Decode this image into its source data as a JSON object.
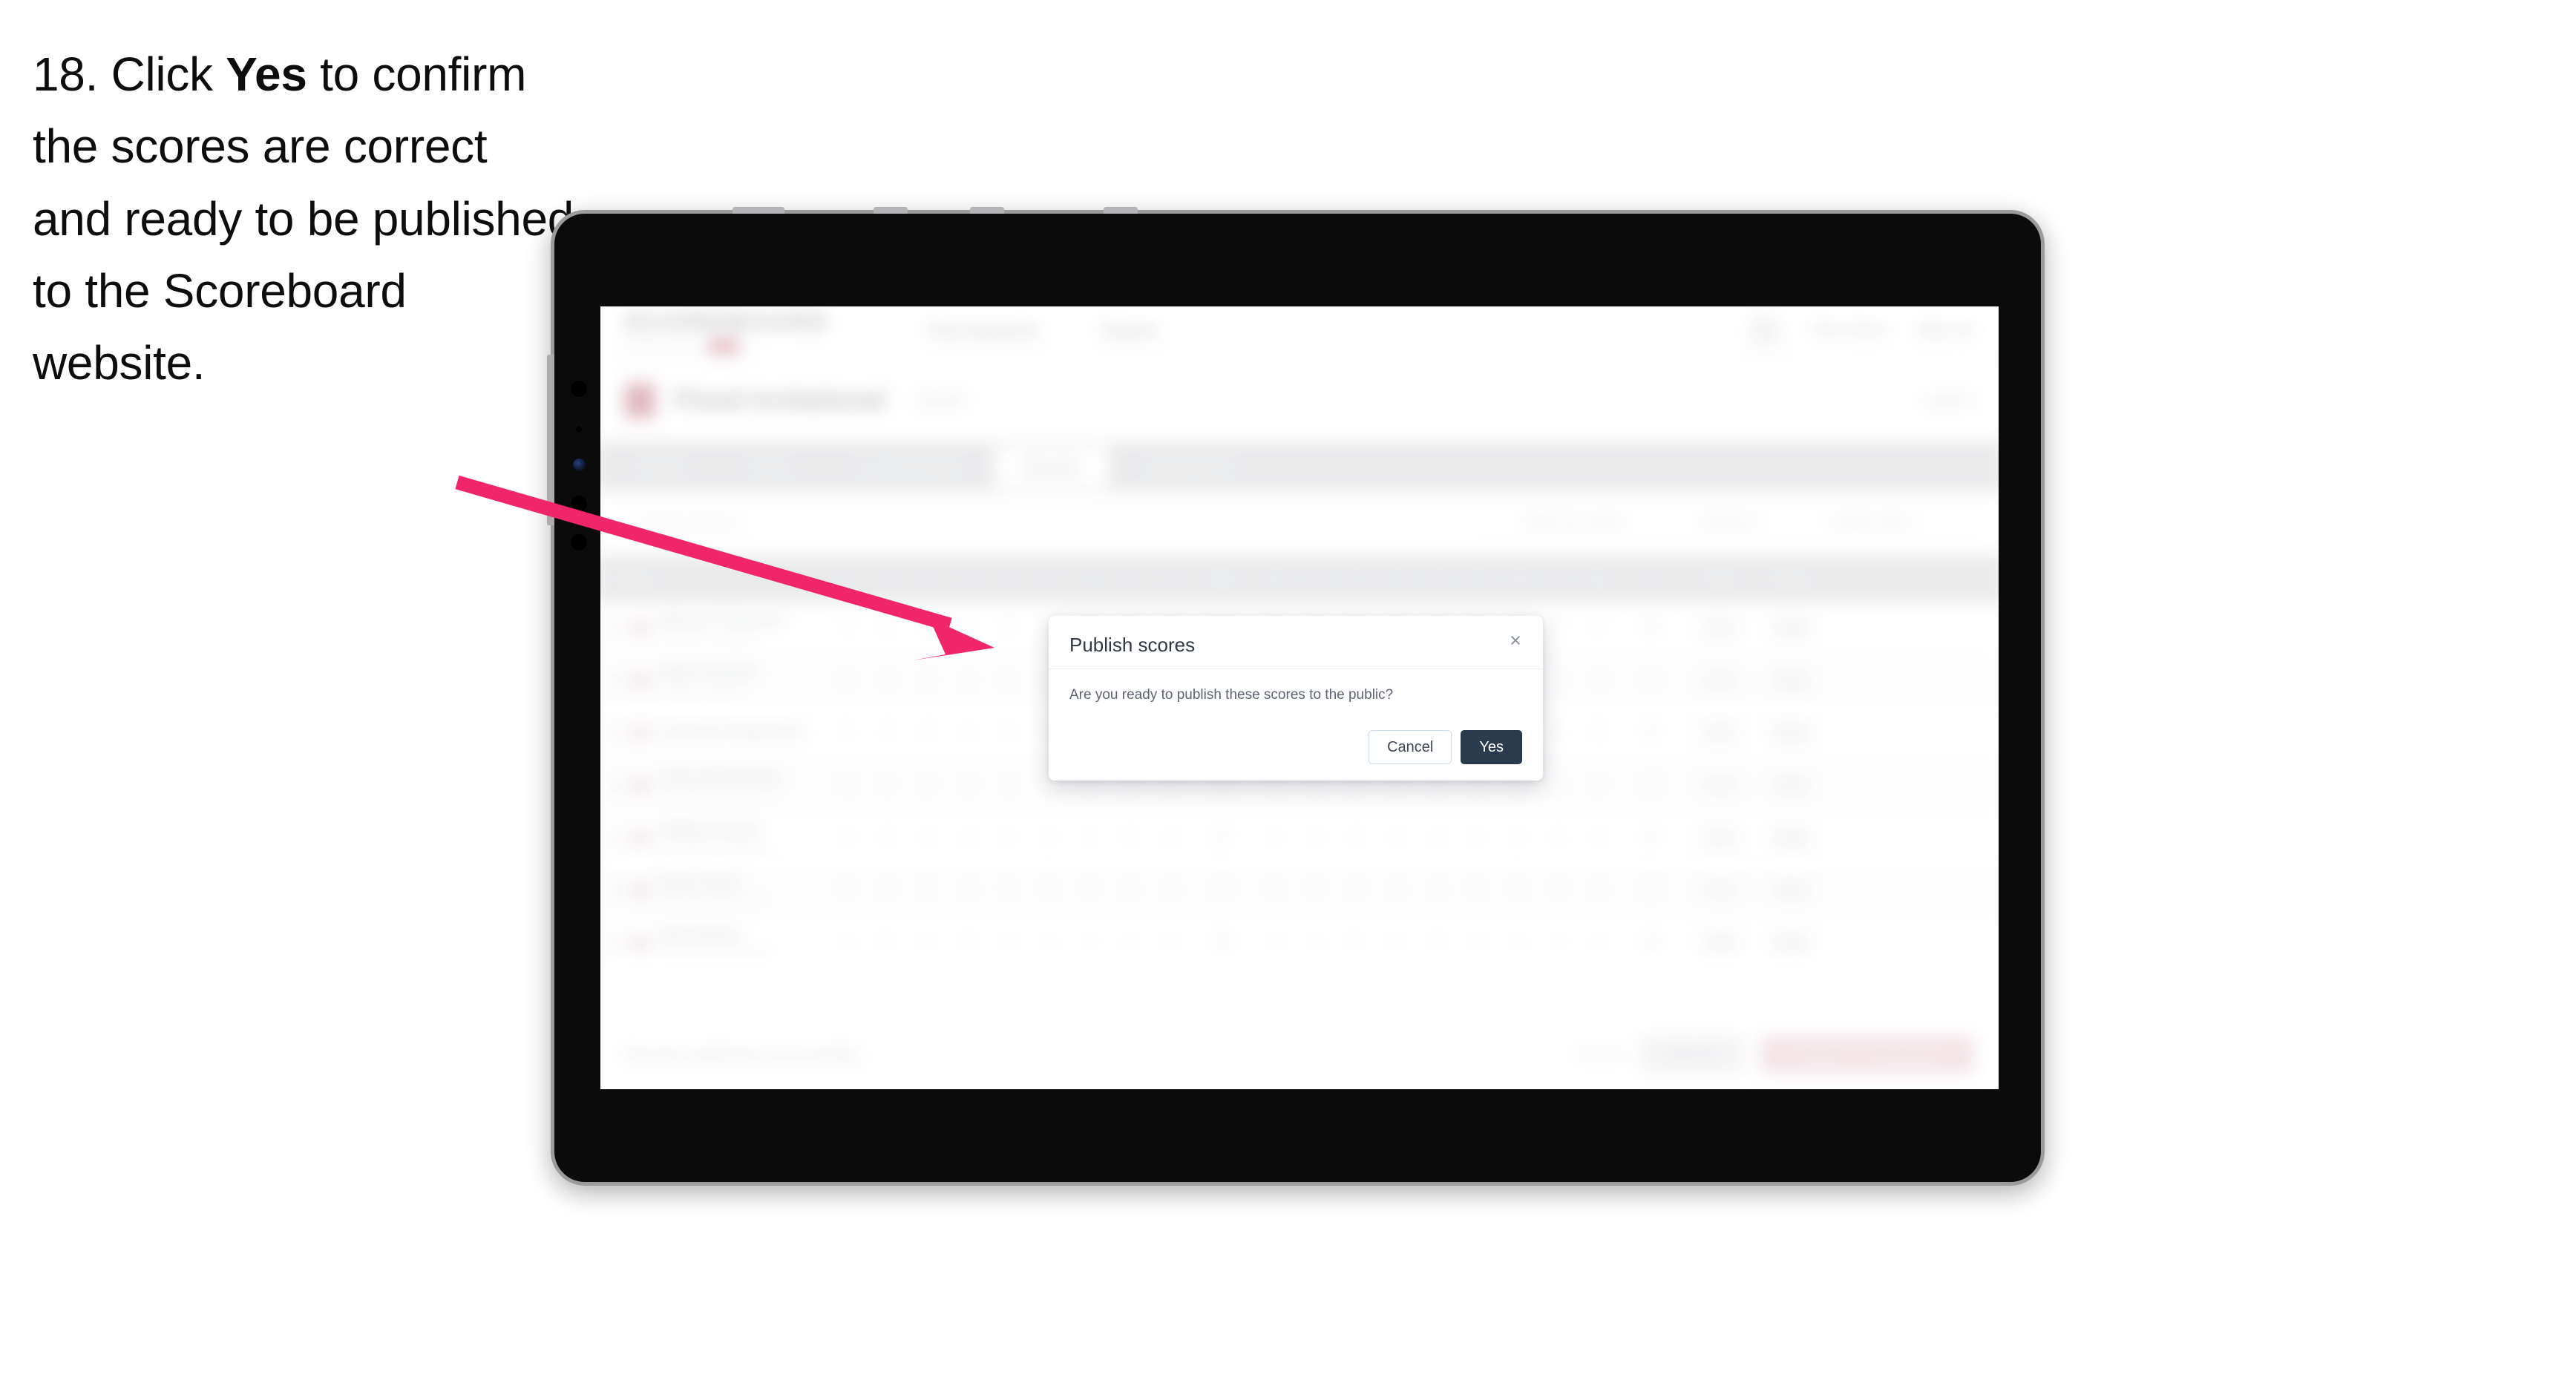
{
  "caption": {
    "step_number": "18.",
    "text_before": "Click ",
    "emphasis": "Yes",
    "text_after": " to confirm the scores are correct and ready to be published to the Scoreboard website."
  },
  "annotation": {
    "arrow_color": "#f0256a",
    "arrow_name": "pointer-arrow"
  },
  "device": {
    "type": "tablet",
    "body_color": "#0b0b0b",
    "bezel_color": "#9b9b9d"
  },
  "app": {
    "header": {
      "brand_word": "SCOREBOARD",
      "brand_sub_text": "POWERED BY",
      "brand_chip": "ITF",
      "nav": [
        {
          "label": "Tournaments"
        },
        {
          "label": "Teams"
        }
      ],
      "right": [
        {
          "label": "Tom Jones"
        },
        {
          "label": "Sign out"
        }
      ]
    },
    "tournament": {
      "name": "Flood Invitational",
      "meta": "2024",
      "right_label": "Level 3"
    },
    "tabs": [
      {
        "label": "Details"
      },
      {
        "label": "Teams"
      },
      {
        "label": "Courses/Rules"
      },
      {
        "label": "Results"
      },
      {
        "label": "Leaderboard"
      }
    ],
    "active_tab": "Results",
    "filters": {
      "search_placeholder": "Search players",
      "pills": [
        {
          "label": "Filter by round"
        },
        {
          "label": "Round 1"
        },
        {
          "label": "Order entry"
        }
      ]
    },
    "table": {
      "columns": [
        "Player",
        "1",
        "2",
        "3",
        "4",
        "5",
        "6",
        "7",
        "8",
        "9",
        "Out",
        "10",
        "11",
        "12",
        "13",
        "14",
        "15",
        "16",
        "17",
        "18",
        "In",
        "Total",
        "Status"
      ],
      "rows": [
        {
          "name": "Marcus Thomson",
          "sub": "Eastvale Collegiate",
          "holes": [
            "4",
            "5",
            "3",
            "4",
            "5",
            "4",
            "3",
            "4",
            "4"
          ],
          "out": "36",
          "holes_in": [
            "4",
            "4",
            "5",
            "3",
            "4",
            "4",
            "5",
            "3",
            "4"
          ],
          "in": "36",
          "total": "72",
          "status": "Final"
        },
        {
          "name": "Rhys Pennell",
          "sub": "Everton College",
          "holes": [
            "5",
            "4",
            "4",
            "3",
            "5",
            "4",
            "4",
            "4",
            "3"
          ],
          "out": "36",
          "holes_in": [
            "4",
            "5",
            "4",
            "4",
            "3",
            "5",
            "4",
            "4",
            "4"
          ],
          "in": "37",
          "total": "73",
          "status": "Final"
        },
        {
          "name": "Cameron Robertson",
          "sub": "",
          "holes": [
            "4",
            "4",
            "4",
            "4",
            "4",
            "4",
            "4",
            "4",
            "4"
          ],
          "out": "36",
          "holes_in": [
            "4",
            "4",
            "4",
            "4",
            "4",
            "4",
            "4",
            "4",
            "5"
          ],
          "in": "37",
          "total": "73",
          "status": "Final"
        },
        {
          "name": "Chris McKechnie",
          "sub": "North Shore Grammar",
          "holes": [
            "5",
            "4",
            "3",
            "4",
            "4",
            "5",
            "4",
            "3",
            "4"
          ],
          "out": "36",
          "holes_in": [
            "5",
            "4",
            "4",
            "4",
            "3",
            "4",
            "5",
            "4",
            "4"
          ],
          "in": "37",
          "total": "73",
          "status": "Final"
        },
        {
          "name": "William Stuart",
          "sub": "Southbank Collegiate",
          "holes": [
            "4",
            "5",
            "4",
            "4",
            "4",
            "3",
            "4",
            "5",
            "4"
          ],
          "out": "37",
          "holes_in": [
            "4",
            "4",
            "5",
            "4",
            "4",
            "4",
            "3",
            "5",
            "4"
          ],
          "in": "37",
          "total": "74",
          "status": "Final"
        },
        {
          "name": "Ryan Kirby",
          "sub": "Crestwood Academy",
          "holes": [
            "4",
            "4",
            "5",
            "4",
            "4",
            "4",
            "4",
            "4",
            "4"
          ],
          "out": "37",
          "holes_in": [
            "5",
            "4",
            "4",
            "4",
            "4",
            "5",
            "4",
            "4",
            "4"
          ],
          "in": "38",
          "total": "75",
          "status": "Final"
        },
        {
          "name": "Nick Bailey",
          "sub": "Hartley Park Grammar",
          "holes": [
            "4",
            "5",
            "4",
            "5",
            "4",
            "4",
            "4",
            "4",
            "4"
          ],
          "out": "38",
          "holes_in": [
            "4",
            "4",
            "5",
            "4",
            "5",
            "4",
            "4",
            "4",
            "4"
          ],
          "in": "38",
          "total": "76",
          "status": "Final"
        }
      ]
    },
    "footer": {
      "note": "Results published successfully.",
      "cancel_label": "Cancel",
      "save_label": "Save all",
      "publish_label": "Publish to Scoreboard"
    }
  },
  "dialog": {
    "title": "Publish scores",
    "close_icon": "×",
    "message": "Are you ready to publish these scores to the public?",
    "cancel_label": "Cancel",
    "confirm_label": "Yes",
    "confirm_bg": "#2c3a4f"
  }
}
